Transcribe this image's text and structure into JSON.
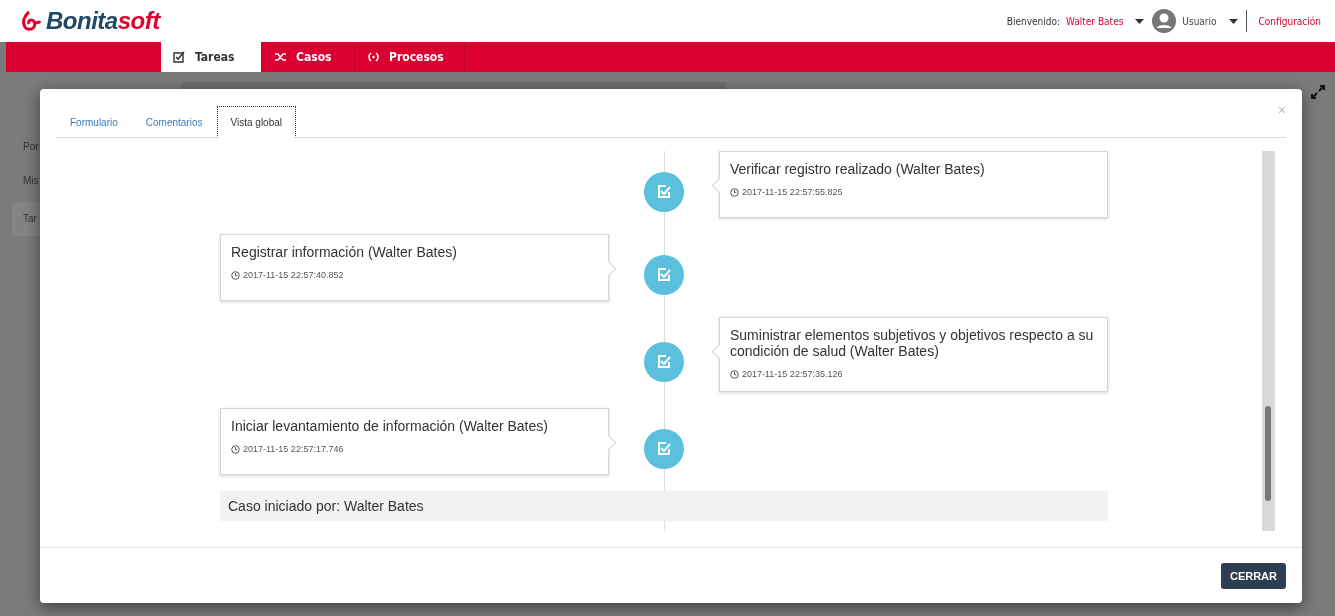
{
  "header": {
    "logo_main": "Bonita",
    "logo_accent": "soft",
    "welcome_label": "Bienvenido:",
    "user_name": "Walter Bates",
    "profile": "Usuario",
    "settings_link": "Configuración"
  },
  "nav_tabs": [
    {
      "label": "Tareas",
      "selected": true
    },
    {
      "label": "Casos",
      "selected": false
    },
    {
      "label": "Procesos",
      "selected": false
    }
  ],
  "sidebar_items": [
    {
      "label": "Por",
      "selected": false
    },
    {
      "label": "Mis",
      "selected": false
    },
    {
      "label": "Tar",
      "selected": true
    }
  ],
  "modal": {
    "close_symbol": "×",
    "tabs": [
      {
        "label": "Formulario",
        "selected": false
      },
      {
        "label": "Comentarios",
        "selected": false
      },
      {
        "label": "Vista global",
        "selected": true
      }
    ],
    "timeline": [
      {
        "kind": "right",
        "title": "Verificar registro realizado (Walter Bates)",
        "time": "2017-11-15 22:57:55.825"
      },
      {
        "kind": "left",
        "title": "Registrar información (Walter Bates)",
        "time": "2017-11-15 22:57:40.852"
      },
      {
        "kind": "right",
        "title": "Suministrar elementos subjetivos y objetivos respecto a su condición de salud (Walter Bates)",
        "time": "2017-11-15 22:57:35.126"
      },
      {
        "kind": "left",
        "title": "Iniciar levantamiento de información (Walter Bates)",
        "time": "2017-11-15 22:57:17.746"
      }
    ],
    "case_started": "Caso iniciado por: Walter Bates",
    "close_button": "CERRAR"
  }
}
